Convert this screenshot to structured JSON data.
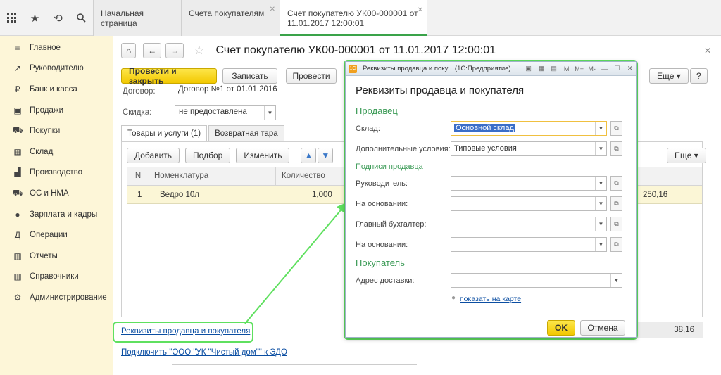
{
  "topbar": {
    "icons": [
      "apps-grid-icon",
      "star-icon",
      "history-icon",
      "search-icon"
    ],
    "tabs": [
      {
        "label": "Начальная страница"
      },
      {
        "label": "Счета покупателям"
      },
      {
        "label": "Счет покупателю УК00-000001 от 11.01.2017 12:00:01",
        "line1": "Счет покупателю УК00-000001 от",
        "line2": "11.01.2017 12:00:01"
      }
    ]
  },
  "sidebar": {
    "items": [
      {
        "label": "Главное",
        "icon": "≡"
      },
      {
        "label": "Руководителю",
        "icon": "↗"
      },
      {
        "label": "Банк и касса",
        "icon": "₽"
      },
      {
        "label": "Продажи",
        "icon": "▣"
      },
      {
        "label": "Покупки",
        "icon": "⛟"
      },
      {
        "label": "Склад",
        "icon": "▦"
      },
      {
        "label": "Производство",
        "icon": "▟"
      },
      {
        "label": "ОС и НМА",
        "icon": "⛟"
      },
      {
        "label": "Зарплата и кадры",
        "icon": "●"
      },
      {
        "label": "Операции",
        "icon": "Д"
      },
      {
        "label": "Отчеты",
        "icon": "▥"
      },
      {
        "label": "Справочники",
        "icon": "▥"
      },
      {
        "label": "Администрирование",
        "icon": "⚙"
      }
    ]
  },
  "doc": {
    "title": "Счет покупателю УК00-000001 от 11.01.2017 12:00:01",
    "btn_post_close": "Провести и закрыть",
    "btn_save": "Записать",
    "btn_post": "Провести",
    "btn_more": "Еще",
    "btn_help": "?",
    "contract_label": "Договор:",
    "contract_value": "Договор №1 от 01.01.2016",
    "discount_label": "Скидка:",
    "discount_value": "не предоставлена",
    "tab_goods": "Товары и услуги (1)",
    "tab_returnable": "Возвратная тара",
    "btn_add": "Добавить",
    "btn_pick": "Подбор",
    "btn_edit": "Изменить",
    "btn_more2": "Еще",
    "columns": [
      "N",
      "Номенклатура",
      "Количество"
    ],
    "row": {
      "n": "1",
      "item": "Ведро 10л",
      "qty": "1,000",
      "sum": "250,16"
    },
    "total": "38,16",
    "link_details": "Реквизиты продавца и покупателя",
    "link_edo": "Подключить \"ООО \"УК \"Чистый дом\"\" к ЭДО"
  },
  "dialog": {
    "window_title": "Реквизиты продавца и поку... (1С:Предприятие)",
    "heading": "Реквизиты продавца и покупателя",
    "seller_section": "Продавец",
    "warehouse_label": "Склад:",
    "warehouse_value": "Основной склад",
    "terms_label": "Дополнительные условия:",
    "terms_value": "Типовые условия",
    "signatures_section": "Подписи продавца",
    "head_label": "Руководитель:",
    "basis_label1": "На основании:",
    "accountant_label": "Главный бухгалтер:",
    "basis_label2": "На основании:",
    "buyer_section": "Покупатель",
    "address_label": "Адрес доставки:",
    "map_link": "показать на карте",
    "btn_ok": "OK",
    "btn_cancel": "Отмена",
    "titlebar_m": "M",
    "titlebar_mplus": "M+",
    "titlebar_mminus": "M-"
  },
  "colors": {
    "accent_green": "#5fe05f",
    "sidebar_bg": "#fdf6d8",
    "primary_button": "#f2c800"
  }
}
